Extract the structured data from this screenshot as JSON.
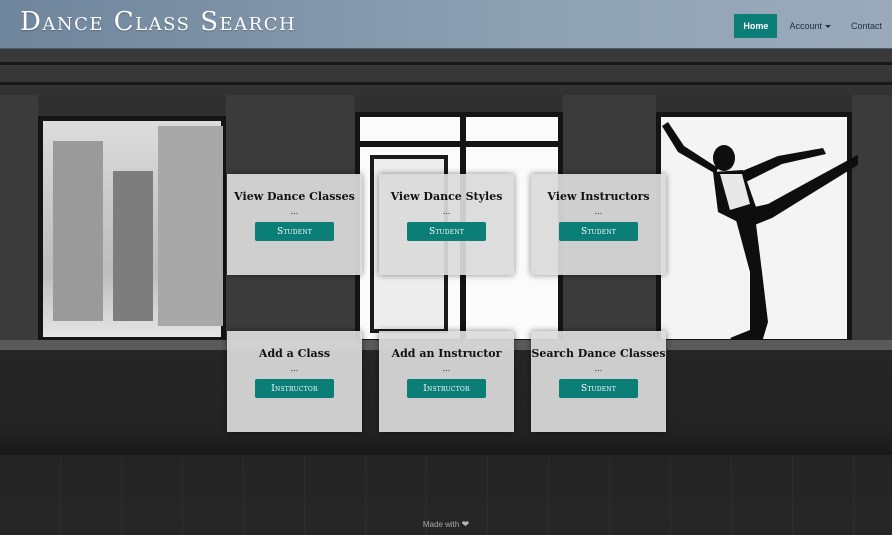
{
  "navbar": {
    "brand": "Dance Class Search",
    "items": [
      {
        "label": "Home",
        "active": true
      },
      {
        "label": "Account",
        "dropdown": true
      },
      {
        "label": "Contact"
      }
    ]
  },
  "cards": [
    {
      "title": "View Dance Classes",
      "dots": "...",
      "button": "Student"
    },
    {
      "title": "View Dance Styles",
      "dots": "...",
      "button": "Student"
    },
    {
      "title": "View Instructors",
      "dots": "...",
      "button": "Student"
    },
    {
      "title": "Add a Class",
      "dots": "...",
      "button": "Instructor"
    },
    {
      "title": "Add an Instructor",
      "dots": "...",
      "button": "Instructor"
    },
    {
      "title": "Search Dance Classes",
      "dots": "...",
      "button": "Student"
    }
  ],
  "footer": {
    "text": "Made with",
    "icon": "heart-icon"
  },
  "colors": {
    "accent": "#0b7e78",
    "navbar": "#8ea2b4"
  }
}
